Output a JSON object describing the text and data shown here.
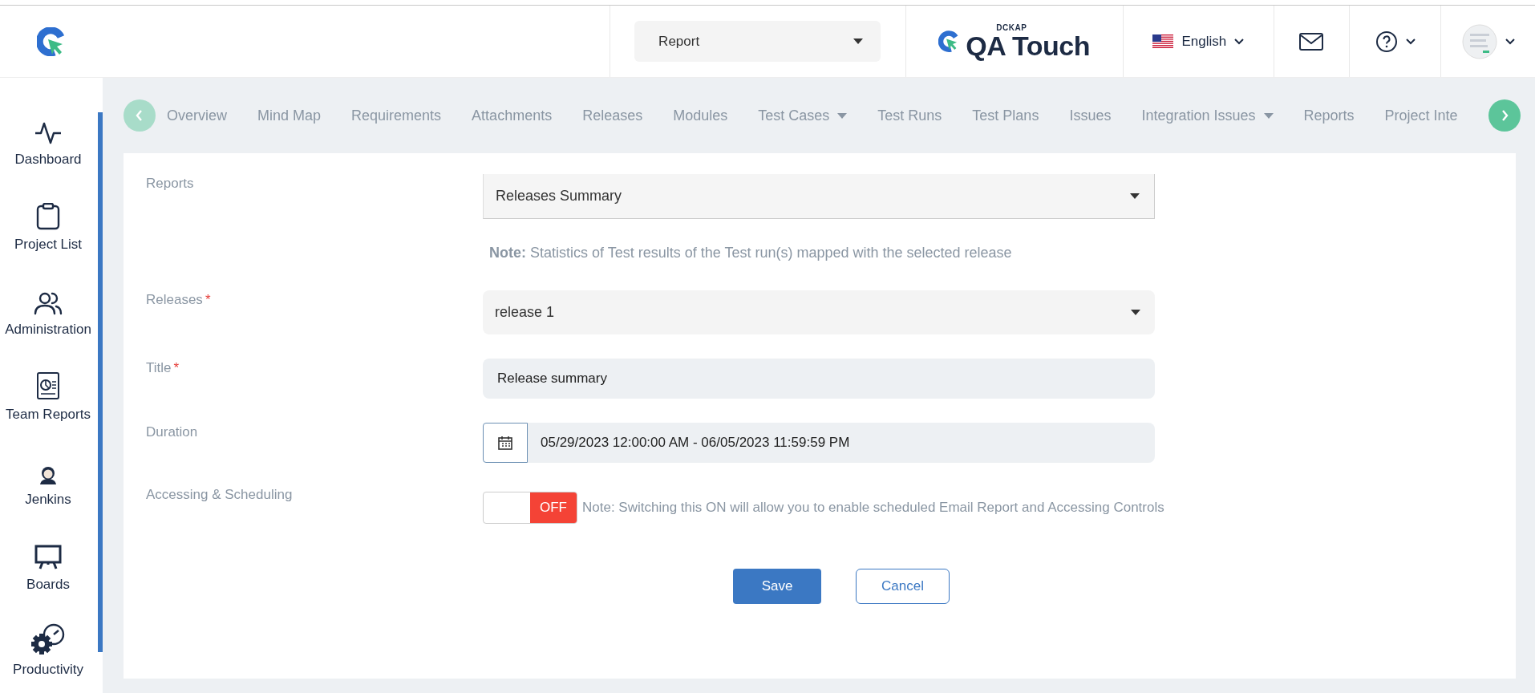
{
  "top_bar": {
    "project_selector": {
      "value": "Report"
    },
    "brand": {
      "small": "DCKAP",
      "name": "QA Touch"
    },
    "language": "English"
  },
  "sidebar": {
    "items": [
      {
        "kind": "pulse",
        "label": "Dashboard"
      },
      {
        "kind": "clipboard",
        "label": "Project List"
      },
      {
        "kind": "users",
        "label": "Administration"
      },
      {
        "kind": "report",
        "label": "Team Reports"
      },
      {
        "kind": "jenkins",
        "label": "Jenkins"
      },
      {
        "kind": "board",
        "label": "Boards"
      },
      {
        "kind": "gear",
        "label": "Productivity"
      }
    ]
  },
  "tab_nav": {
    "prev": {
      "disabled": true
    },
    "next": {
      "disabled": false
    }
  },
  "tabs": [
    {
      "label": "Overview",
      "dropdown": false
    },
    {
      "label": "Mind Map",
      "dropdown": false
    },
    {
      "label": "Requirements",
      "dropdown": false
    },
    {
      "label": "Attachments",
      "dropdown": false
    },
    {
      "label": "Releases",
      "dropdown": false
    },
    {
      "label": "Modules",
      "dropdown": false
    },
    {
      "label": "Test Cases",
      "dropdown": true
    },
    {
      "label": "Test Runs",
      "dropdown": false
    },
    {
      "label": "Test Plans",
      "dropdown": false
    },
    {
      "label": "Issues",
      "dropdown": false
    },
    {
      "label": "Integration Issues",
      "dropdown": true
    },
    {
      "label": "Reports",
      "dropdown": false
    },
    {
      "label": "Project Inte",
      "dropdown": false
    }
  ],
  "form": {
    "rows": [
      {
        "kind": "select",
        "label": "Reports",
        "value": "Releases Summary",
        "note": "**Note:** Statistics of Test results of the Test run(s) mapped with the selected release"
      },
      {
        "kind": "select-rounded",
        "label": "Releases",
        "required_mark": "*",
        "value": "release 1"
      },
      {
        "kind": "input",
        "label": "Title",
        "required_mark": "*",
        "value": "Release summary"
      },
      {
        "kind": "daterange",
        "label": "Duration",
        "value": "05/29/2023 12:00:00 AM - 06/05/2023 11:59:59 PM"
      },
      {
        "kind": "toggle",
        "label": "Accessing & Scheduling",
        "on": false,
        "toggle_text": "OFF",
        "note": "Note: Switching this ON will allow you to enable scheduled Email Report and Accessing Controls"
      }
    ],
    "buttons": [
      {
        "kind": "primary",
        "label": "Save"
      },
      {
        "kind": "secondary",
        "label": "Cancel"
      }
    ]
  }
}
